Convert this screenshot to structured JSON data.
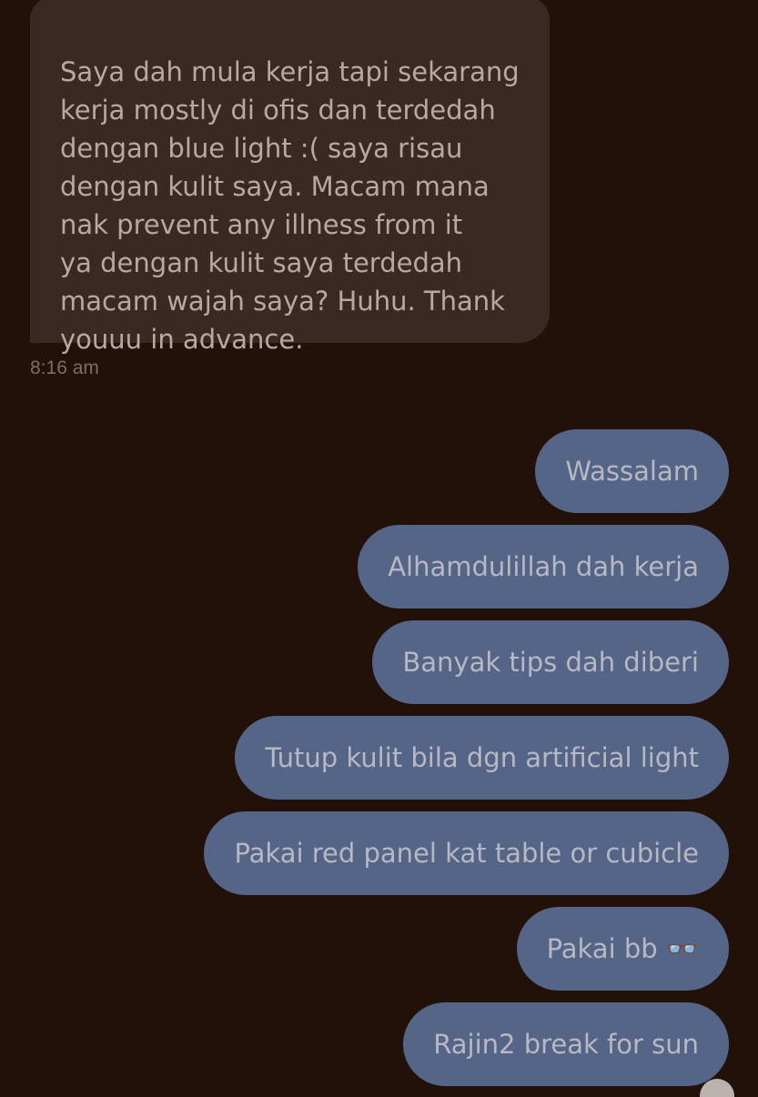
{
  "conversation": {
    "incoming_message": {
      "text": "Saya dah mula kerja tapi sekarang\nkerja mostly di ofis dan terdedah\ndengan blue light :( saya risau\ndengan kulit saya. Macam mana\nnak prevent any illness from it\nya dengan kulit saya terdedah\nmacam wajah saya? Huhu. Thank\nyouuu in advance.",
      "timestamp": "8:16 am"
    },
    "outgoing_messages": [
      {
        "text": "Wassalam"
      },
      {
        "text": "Alhamdulillah dah kerja"
      },
      {
        "text": "Banyak tips dah diberi"
      },
      {
        "text": "Tutup kulit bila dgn artificial light"
      },
      {
        "text": "Pakai red panel kat table or cubicle"
      },
      {
        "text": "Pakai bb 👓"
      },
      {
        "text": "Rajin2 break for sun"
      }
    ]
  },
  "colors": {
    "background": "#221109",
    "incoming_bubble": "#3b2823",
    "outgoing_bubble": "#556587",
    "incoming_text": "#b8a8a3",
    "outgoing_text": "#b7b8c1",
    "timestamp_text": "#7b6d68"
  },
  "icons": {
    "glasses_emoji": "glasses-icon",
    "partial_avatar": "avatar"
  }
}
